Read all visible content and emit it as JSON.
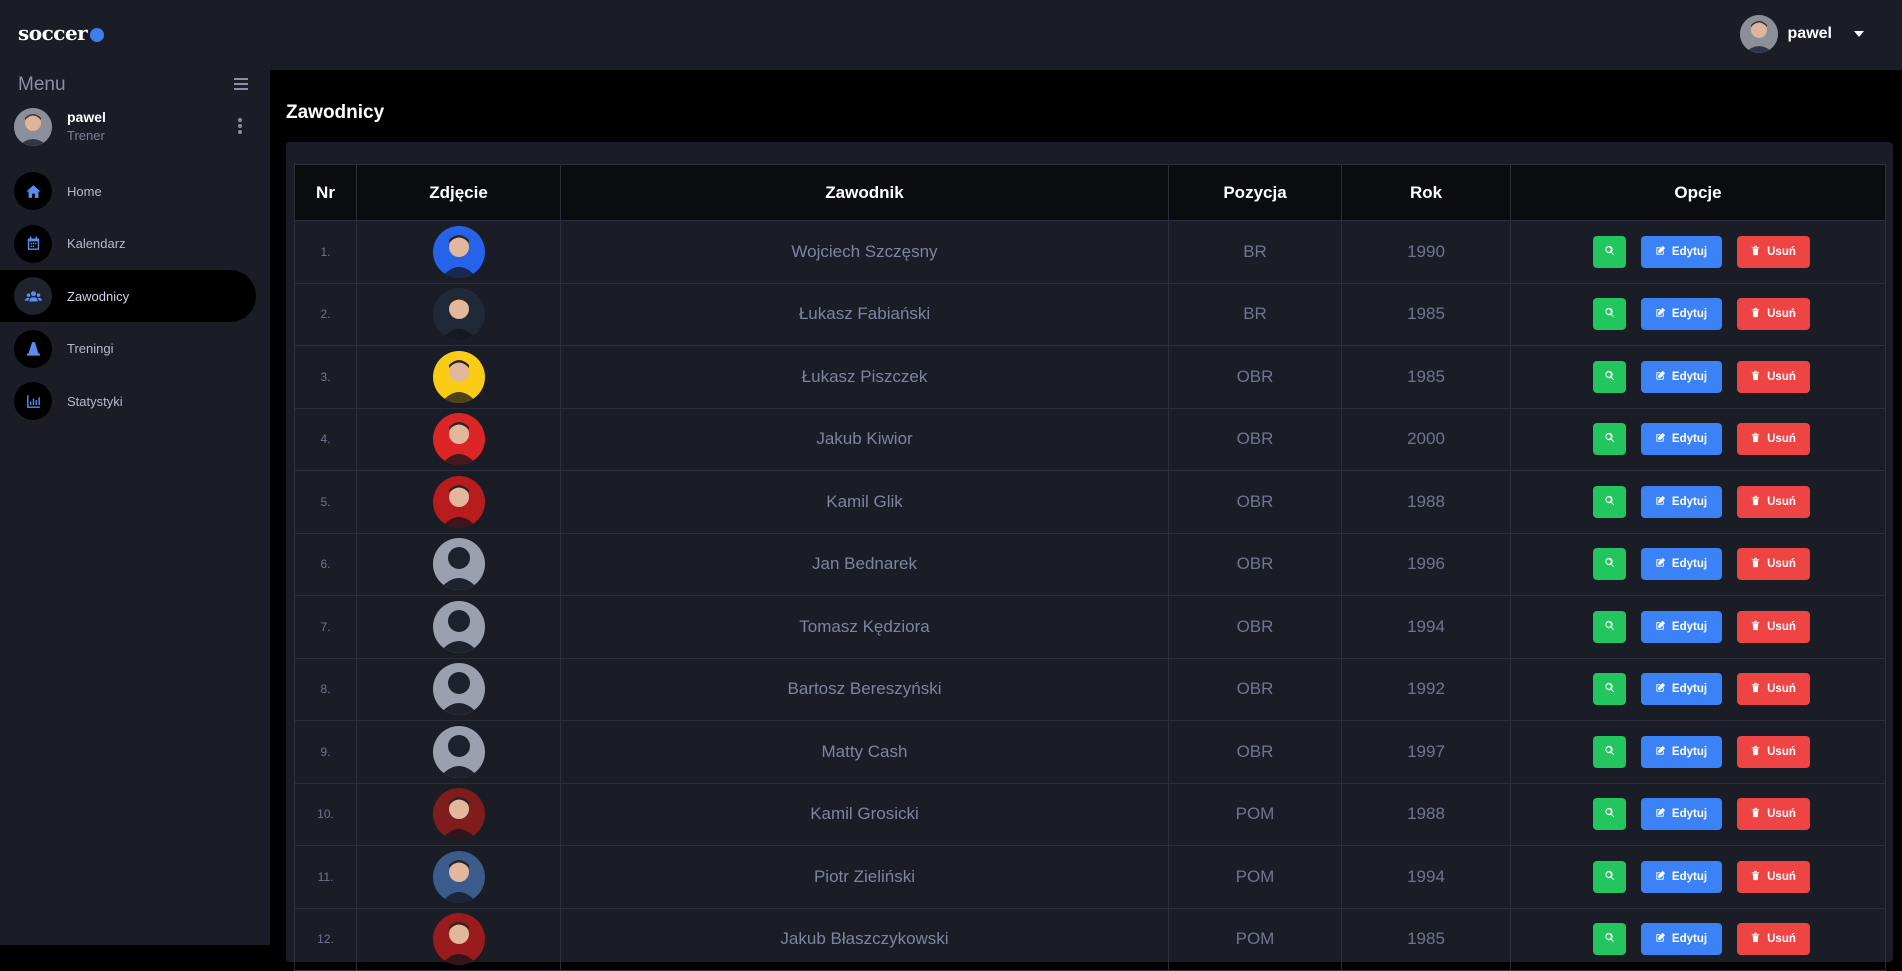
{
  "brand": "soccer",
  "top_user": {
    "name": "pawel"
  },
  "sidebar": {
    "menu_title": "Menu",
    "user": {
      "name": "pawel",
      "role": "Trener"
    },
    "items": [
      {
        "label": "Home",
        "icon": "home-icon"
      },
      {
        "label": "Kalendarz",
        "icon": "calendar-icon"
      },
      {
        "label": "Zawodnicy",
        "icon": "users-icon",
        "active": true
      },
      {
        "label": "Treningi",
        "icon": "cone-icon"
      },
      {
        "label": "Statystyki",
        "icon": "chart-icon"
      }
    ]
  },
  "page": {
    "title": "Zawodnicy"
  },
  "table": {
    "headers": [
      "Nr",
      "Zdjęcie",
      "Zawodnik",
      "Pozycja",
      "Rok",
      "Opcje"
    ],
    "edit_label": "Edytuj",
    "delete_label": "Usuń",
    "rows": [
      {
        "nr": "1.",
        "name": "Wojciech Szczęsny",
        "pos": "BR",
        "rok": "1990",
        "photo": "#2563eb"
      },
      {
        "nr": "2.",
        "name": "Łukasz Fabiański",
        "pos": "BR",
        "rok": "1985",
        "photo": "#1f2937"
      },
      {
        "nr": "3.",
        "name": "Łukasz Piszczek",
        "pos": "OBR",
        "rok": "1985",
        "photo": "#facc15"
      },
      {
        "nr": "4.",
        "name": "Jakub Kiwior",
        "pos": "OBR",
        "rok": "2000",
        "photo": "#dc2626"
      },
      {
        "nr": "5.",
        "name": "Kamil Glik",
        "pos": "OBR",
        "rok": "1988",
        "photo": "#b91c1c"
      },
      {
        "nr": "6.",
        "name": "Jan Bednarek",
        "pos": "OBR",
        "rok": "1996",
        "photo": "placeholder"
      },
      {
        "nr": "7.",
        "name": "Tomasz Kędziora",
        "pos": "OBR",
        "rok": "1994",
        "photo": "placeholder"
      },
      {
        "nr": "8.",
        "name": "Bartosz Bereszyński",
        "pos": "OBR",
        "rok": "1992",
        "photo": "placeholder"
      },
      {
        "nr": "9.",
        "name": "Matty Cash",
        "pos": "OBR",
        "rok": "1997",
        "photo": "placeholder"
      },
      {
        "nr": "10.",
        "name": "Kamil Grosicki",
        "pos": "POM",
        "rok": "1988",
        "photo": "#7f1d1d"
      },
      {
        "nr": "11.",
        "name": "Piotr Zieliński",
        "pos": "POM",
        "rok": "1994",
        "photo": "#3b5b8c"
      },
      {
        "nr": "12.",
        "name": "Jakub Błaszczykowski",
        "pos": "POM",
        "rok": "1985",
        "photo": "#991b1b"
      }
    ]
  }
}
